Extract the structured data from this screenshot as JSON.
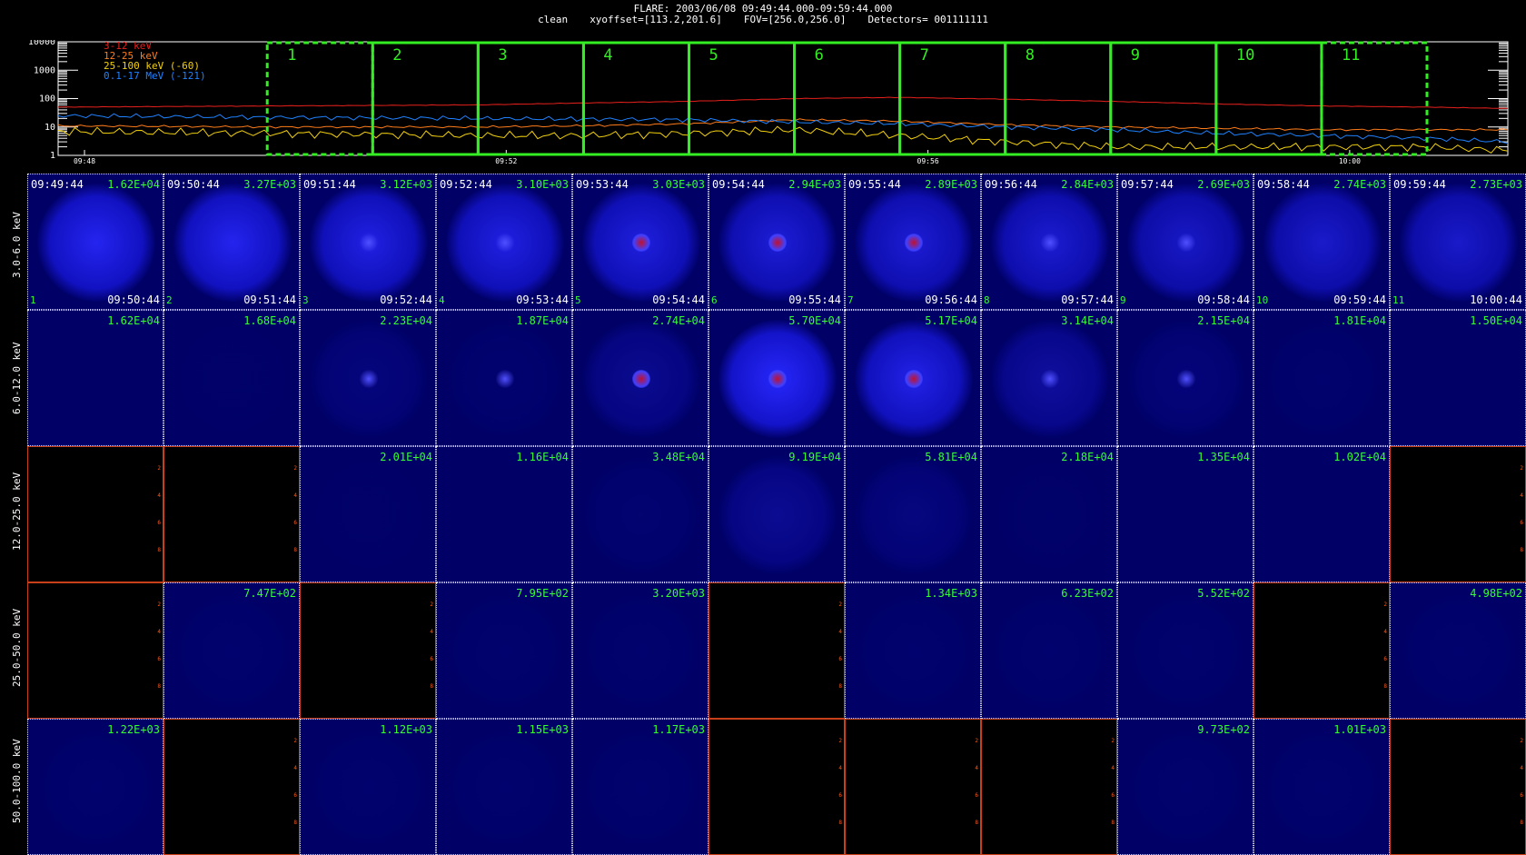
{
  "header": {
    "line1": "FLARE: 2003/06/08 09:49:44.000-09:59:44.000",
    "clean": "clean",
    "xyoffset": "xyoffset=[113.2,201.6]",
    "fov": "FOV=[256.0,256.0]",
    "detectors": "Detectors= 001111111"
  },
  "chart_data": [
    {
      "type": "line",
      "ylog": true,
      "yticks": [
        "10000",
        "1000",
        "100",
        "10",
        "1"
      ],
      "ylim": [
        1,
        10000
      ],
      "xlim": [
        "09:47:45",
        "10:01:30"
      ],
      "xticks": [
        "09:48",
        "09:52",
        "09:56",
        "10:00"
      ],
      "series": [
        {
          "name": "3-12 keV",
          "color": "#e8201c",
          "x": [
            "09:47:45",
            "09:49:44",
            "09:51:44",
            "09:52:44",
            "09:53:44",
            "09:54:44",
            "09:55:44",
            "09:56:44",
            "09:57:44",
            "09:58:44",
            "09:59:44",
            "10:00:44",
            "10:01:30"
          ],
          "values": [
            50,
            55,
            60,
            70,
            80,
            100,
            110,
            95,
            80,
            65,
            55,
            50,
            45
          ]
        },
        {
          "name": "12-25 keV",
          "color": "#ff7c1a",
          "x": [
            "09:47:45",
            "09:49:44",
            "09:51:44",
            "09:52:44",
            "09:53:44",
            "09:54:44",
            "09:55:44",
            "09:56:44",
            "09:57:44",
            "09:58:44",
            "09:59:44",
            "10:00:44",
            "10:01:30"
          ],
          "values": [
            11,
            10,
            10,
            11,
            13,
            18,
            16,
            12,
            10,
            9,
            8,
            8,
            8
          ]
        },
        {
          "name": "25-100 keV (-60)",
          "color": "#f2d00a",
          "x": [
            "09:47:45",
            "09:49:44",
            "09:51:44",
            "09:52:44",
            "09:53:44",
            "09:54:44",
            "09:55:44",
            "09:56:44",
            "09:57:44",
            "09:58:44",
            "09:59:44",
            "10:00:44",
            "10:01:30"
          ],
          "values": [
            7,
            6,
            5,
            5,
            6,
            8,
            5,
            3,
            2,
            2,
            2,
            2,
            1.5
          ]
        },
        {
          "name": "0.1-17 MeV (-121)",
          "color": "#1e82ff",
          "x": [
            "09:47:45",
            "09:49:44",
            "09:51:44",
            "09:52:44",
            "09:53:44",
            "09:54:44",
            "09:55:44",
            "09:56:44",
            "09:57:44",
            "09:58:44",
            "09:59:44",
            "10:00:44",
            "10:01:30"
          ],
          "values": [
            25,
            22,
            20,
            19,
            18,
            15,
            13,
            10,
            8,
            6,
            5,
            4,
            3
          ]
        }
      ],
      "intervals": {
        "labels": [
          "1",
          "2",
          "3",
          "4",
          "5",
          "6",
          "7",
          "8",
          "9",
          "10",
          "11"
        ],
        "start": "09:49:44",
        "step_minutes": 1,
        "color": "#33ee22"
      }
    },
    {
      "type": "heatmap",
      "row_labels": [
        "3.0-6.0 keV",
        "6.0-12.0 keV",
        "12.0-25.0 keV",
        "25.0-50.0 keV",
        "50.0-100.0 keV"
      ],
      "interval_index": [
        "1",
        "2",
        "3",
        "4",
        "5",
        "6",
        "7",
        "8",
        "9",
        "10",
        "11"
      ],
      "start_times": [
        "09:49:44",
        "09:50:44",
        "09:51:44",
        "09:52:44",
        "09:53:44",
        "09:54:44",
        "09:55:44",
        "09:56:44",
        "09:57:44",
        "09:58:44",
        "09:59:44"
      ],
      "end_times": [
        "09:50:44",
        "09:51:44",
        "09:52:44",
        "09:53:44",
        "09:54:44",
        "09:55:44",
        "09:56:44",
        "09:57:44",
        "09:58:44",
        "09:59:44",
        "10:00:44"
      ],
      "max_values": [
        [
          "1.62E+04",
          "3.27E+03",
          "3.12E+03",
          "3.10E+03",
          "3.03E+03",
          "2.94E+03",
          "2.89E+03",
          "2.84E+03",
          "2.69E+03",
          "2.74E+03",
          "2.73E+03"
        ],
        [
          "1.62E+04",
          "1.68E+04",
          "2.23E+04",
          "1.87E+04",
          "2.74E+04",
          "5.70E+04",
          "5.17E+04",
          "3.14E+04",
          "2.15E+04",
          "1.81E+04",
          "1.50E+04"
        ],
        [
          null,
          null,
          "2.01E+04",
          "1.16E+04",
          "3.48E+04",
          "9.19E+04",
          "5.81E+04",
          "2.18E+04",
          "1.35E+04",
          "1.02E+04",
          null
        ],
        [
          null,
          "7.47E+02",
          null,
          "7.95E+02",
          "3.20E+03",
          null,
          "1.34E+03",
          "6.23E+02",
          "5.52E+02",
          null,
          "4.98E+02"
        ],
        [
          "1.22E+03",
          null,
          "1.12E+03",
          "1.15E+03",
          "1.17E+03",
          null,
          null,
          null,
          "9.73E+02",
          "1.01E+03",
          null
        ]
      ],
      "empty_axis_ticks": [
        "2",
        "4",
        "6",
        "8"
      ]
    }
  ]
}
